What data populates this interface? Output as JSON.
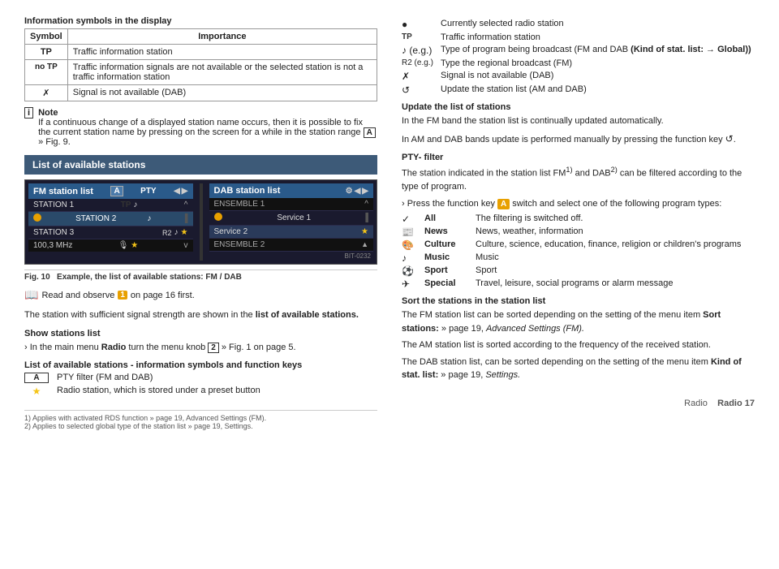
{
  "page": {
    "title": "Radio 17"
  },
  "info_table": {
    "title": "Information symbols in the display",
    "headers": [
      "Symbol",
      "Importance"
    ],
    "rows": [
      {
        "symbol": "TP",
        "importance": "Traffic information station"
      },
      {
        "symbol": "no TP",
        "importance": "Traffic information signals are not available or the selected station is not a traffic information station"
      },
      {
        "symbol": "✗",
        "importance": "Signal is not available (DAB)"
      }
    ]
  },
  "note": {
    "label": "Note",
    "text": "If a continuous change of a displayed station name occurs, then it is possible to fix the current station name by pressing on the screen for a while in the station range",
    "ref": "A",
    "fig_ref": "Fig. 9"
  },
  "section_box": {
    "label": "List of available stations"
  },
  "fm_panel": {
    "header": "FM station list",
    "pty": "PTY",
    "stations": [
      {
        "name": "STATION 1",
        "icons": "TP ♪",
        "arrow": "^"
      },
      {
        "name": "STATION 2",
        "icons": "♪",
        "selected": true
      },
      {
        "name": "STATION 3",
        "icons": "R2 ♪ ★"
      },
      {
        "footer_freq": "100,3 MHz",
        "footer_icons": "🎙 ★"
      }
    ]
  },
  "dab_panel": {
    "header": "DAB station list",
    "ensembles": [
      {
        "name": "ENSEMBLE 1",
        "type": "ensemble",
        "arrow": "^"
      },
      {
        "name": "Service 1",
        "type": "service"
      },
      {
        "name": "Service 2",
        "type": "service",
        "star": true
      },
      {
        "name": "ENSEMBLE 2",
        "type": "ensemble"
      }
    ],
    "bit_label": "BIT-0232"
  },
  "fig_caption": {
    "fig_num": "Fig. 10",
    "text": "Example, the list of available stations: FM / DAB"
  },
  "read_observe": {
    "text_before": "Read and observe",
    "page_ref": "1",
    "text_after": "on page 16 first."
  },
  "body_text1": "The station with sufficient signal strength are shown in the",
  "body_bold1": "list of available stations.",
  "show_stations": {
    "heading": "Show stations list",
    "text": "In the main menu",
    "bold": "Radio",
    "text2": "turn the menu knob",
    "ref": "2",
    "text3": "Fig. 1 on page 5."
  },
  "list_info": {
    "heading": "List of available stations - information symbols and function keys",
    "items": [
      {
        "symbol": "A",
        "text": "PTY filter (FM and DAB)"
      },
      {
        "symbol": "★",
        "text": "Radio station, which is stored under a preset button"
      }
    ]
  },
  "right_col": {
    "items": [
      {
        "symbol": "●",
        "text": "Currently selected radio station"
      },
      {
        "symbol": "TP",
        "text": "Traffic information station"
      },
      {
        "symbol": "♪ (e.g.)",
        "text": "Type of program being broadcast (FM and DAB",
        "bold_end": "(Kind of stat. list: → Global))"
      },
      {
        "symbol": "R2 (e.g.)",
        "text": "Type the regional broadcast (FM)"
      },
      {
        "symbol": "✗",
        "text": "Signal is not available (DAB)"
      },
      {
        "symbol": "↺",
        "text": "Update the station list (AM and DAB)"
      }
    ],
    "update_heading": "Update the list of stations",
    "update_text1": "In the FM band the station list is continually updated automatically.",
    "update_text2": "In AM and DAB bands update is performed manually by pressing the function key ↺.",
    "pty_heading": "PTY- filter",
    "pty_text1": "The station indicated in the station list FM",
    "pty_sup1": "1)",
    "pty_text2": "and DAB",
    "pty_sup2": "2)",
    "pty_text3": "can be filtered according to the type of program.",
    "pty_instruction": "Press the function key",
    "pty_key": "A",
    "pty_instruction2": "switch and select one of the following program types:",
    "pty_types": [
      {
        "icon": "✓",
        "label": "All",
        "text": "The filtering is switched off."
      },
      {
        "icon": "📰",
        "label": "News",
        "text": "News, weather, information"
      },
      {
        "icon": "🎨",
        "label": "Culture",
        "text": "Culture, science, education, finance, religion or children's programs"
      },
      {
        "icon": "♪",
        "label": "Music",
        "text": "Music"
      },
      {
        "icon": "⚽",
        "label": "Sport",
        "text": "Sport"
      },
      {
        "icon": "✈",
        "label": "Special",
        "text": "Travel, leisure, social programs or alarm message"
      }
    ],
    "sort_heading": "Sort the stations in the station list",
    "sort_text1": "The FM station list can be sorted depending on the setting of the menu item",
    "sort_bold1": "Sort stations:",
    "sort_ref1": "» page 19,",
    "sort_italic1": "Advanced Settings (FM).",
    "sort_text2": "The AM station list is sorted according to the frequency of the received station.",
    "sort_text3": "The DAB station list, can be sorted depending on the setting of the menu item",
    "sort_bold2": "Kind of stat. list:",
    "sort_ref2": "» page 19,",
    "sort_italic2": "Settings."
  },
  "footnotes": [
    "1)  Applies with activated RDS function » page 19, Advanced Settings (FM).",
    "2)  Applies to selected global type of the station list » page 19, Settings."
  ]
}
